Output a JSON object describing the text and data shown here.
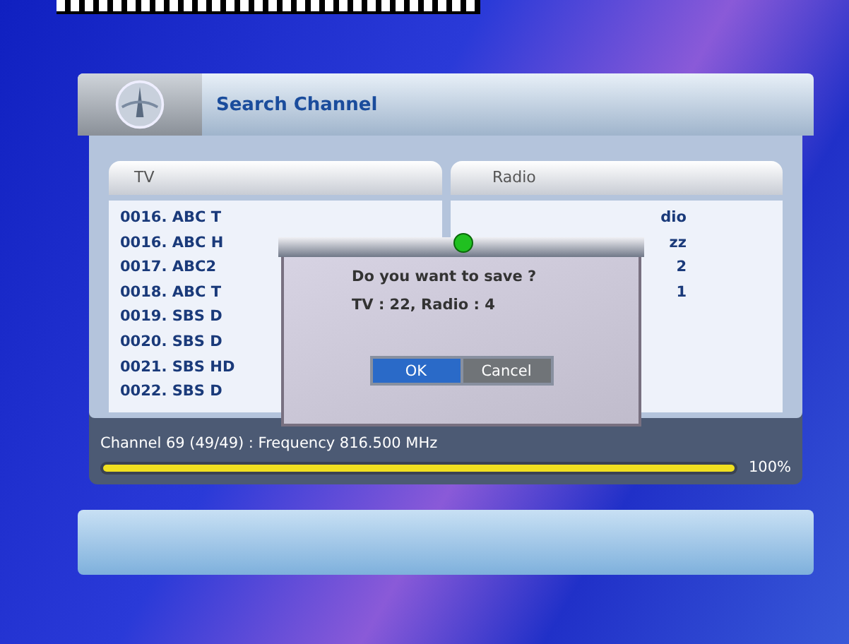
{
  "window": {
    "title": "Search Channel"
  },
  "columns": [
    {
      "label": "TV"
    },
    {
      "label": "Radio"
    }
  ],
  "tv_items": [
    "0016. ABC T",
    "0016. ABC H",
    "0017. ABC2",
    "0018. ABC T",
    "0019. SBS D",
    "0020. SBS D",
    "0021. SBS HD",
    "0022. SBS D"
  ],
  "radio_items": [
    "dio",
    "zz",
    "2",
    "1"
  ],
  "dialog": {
    "message": "Do you want to save ?",
    "summary": "TV : 22,  Radio : 4",
    "buttons": [
      {
        "label": "OK",
        "selected": true
      },
      {
        "label": "Cancel",
        "selected": false
      }
    ]
  },
  "status": {
    "text": "Channel 69 (49/49) : Frequency 816.500 MHz",
    "level": 1,
    "reading": "100%"
  }
}
